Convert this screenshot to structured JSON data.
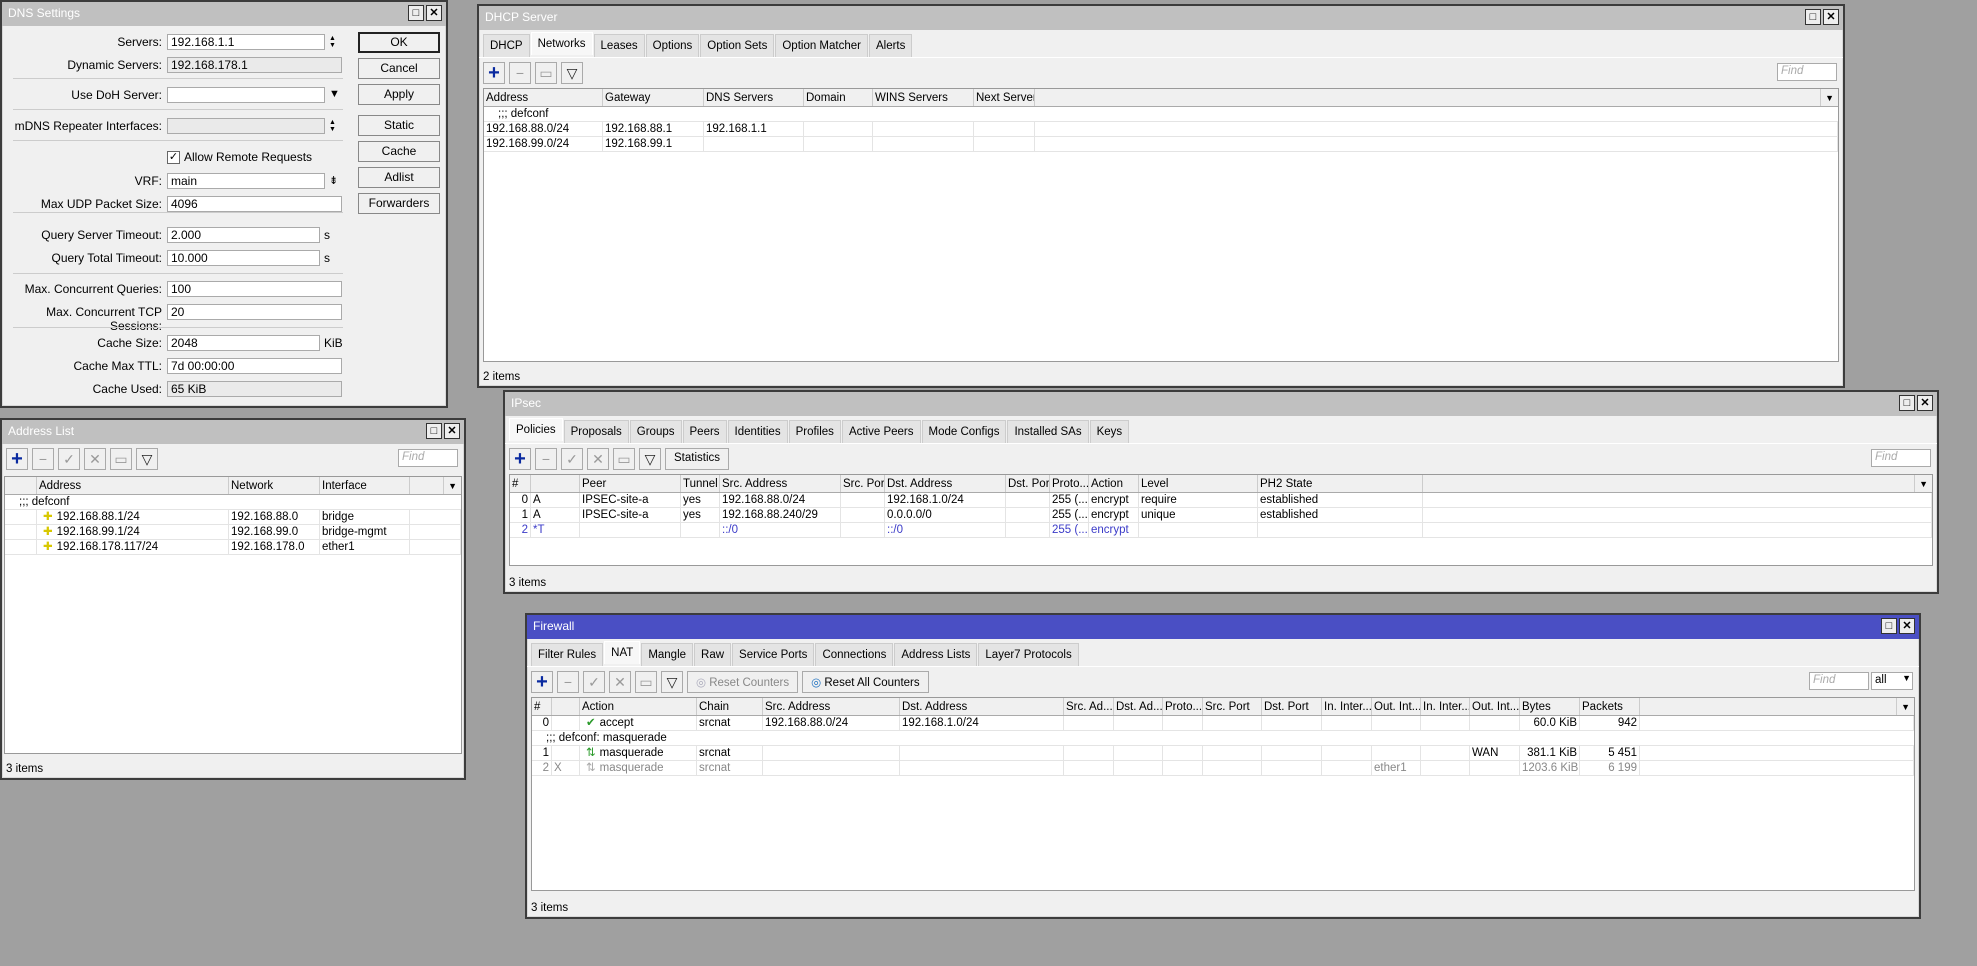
{
  "dns": {
    "title": "DNS Settings",
    "fields": [
      {
        "label": "Servers:",
        "value": "192.168.1.1",
        "ro": false
      },
      {
        "label": "Dynamic Servers:",
        "value": "192.168.178.1",
        "ro": true
      },
      {
        "label": "Use DoH Server:",
        "value": "",
        "ro": false
      },
      {
        "label": "mDNS Repeater Interfaces:",
        "value": "",
        "ro": true
      },
      {
        "label": "VRF:",
        "value": "main",
        "ro": false
      },
      {
        "label": "Max UDP Packet Size:",
        "value": "4096",
        "ro": false
      },
      {
        "label": "Query Server Timeout:",
        "value": "2.000",
        "ro": false,
        "unit": "s"
      },
      {
        "label": "Query Total Timeout:",
        "value": "10.000",
        "ro": false,
        "unit": "s"
      },
      {
        "label": "Max. Concurrent Queries:",
        "value": "100",
        "ro": false
      },
      {
        "label": "Max. Concurrent TCP Sessions:",
        "value": "20",
        "ro": false
      },
      {
        "label": "Cache Size:",
        "value": "2048",
        "ro": false,
        "unit": "KiB"
      },
      {
        "label": "Cache Max TTL:",
        "value": "7d 00:00:00",
        "ro": false
      },
      {
        "label": "Cache Used:",
        "value": "65 KiB",
        "ro": true
      }
    ],
    "allow_remote": {
      "label": "Allow Remote Requests",
      "checked": true
    },
    "buttons": [
      "OK",
      "Cancel",
      "Apply",
      "Static",
      "Cache",
      "Adlist",
      "Forwarders"
    ]
  },
  "addr": {
    "title": "Address List",
    "find": "Find",
    "status": "3 items",
    "columns": [
      "",
      "Address",
      "Network",
      "Interface",
      ""
    ],
    "comment": ";;; defconf",
    "rows": [
      [
        "",
        "192.168.88.1/24",
        "192.168.88.0",
        "bridge",
        ""
      ],
      [
        "",
        "192.168.99.1/24",
        "192.168.99.0",
        "bridge-mgmt",
        ""
      ],
      [
        "",
        "192.168.178.117/24",
        "192.168.178.0",
        "ether1",
        ""
      ]
    ]
  },
  "dhcp": {
    "title": "DHCP Server",
    "tabs": [
      "DHCP",
      "Networks",
      "Leases",
      "Options",
      "Option Sets",
      "Option Matcher",
      "Alerts"
    ],
    "selected_tab": 1,
    "find": "Find",
    "status": "2 items",
    "columns": [
      "Address",
      "Gateway",
      "DNS Servers",
      "Domain",
      "WINS Servers",
      "Next Server",
      ""
    ],
    "comment": ";;; defconf",
    "rows": [
      [
        "192.168.88.0/24",
        "192.168.88.1",
        "192.168.1.1",
        "",
        "",
        "",
        ""
      ],
      [
        "192.168.99.0/24",
        "192.168.99.1",
        "",
        "",
        "",
        "",
        ""
      ]
    ]
  },
  "ipsec": {
    "title": "IPsec",
    "tabs": [
      "Policies",
      "Proposals",
      "Groups",
      "Peers",
      "Identities",
      "Profiles",
      "Active Peers",
      "Mode Configs",
      "Installed SAs",
      "Keys"
    ],
    "selected_tab": 0,
    "statistics": "Statistics",
    "find": "Find",
    "status": "3 items",
    "columns": [
      "#",
      "",
      "Peer",
      "Tunnel",
      "Src. Address",
      "Src. Port",
      "Dst. Address",
      "Dst. Port",
      "Proto...",
      "Action",
      "Level",
      "PH2 State",
      ""
    ],
    "rows": [
      [
        "0",
        "A",
        "IPSEC-site-a",
        "yes",
        "192.168.88.0/24",
        "",
        "192.168.1.0/24",
        "",
        "255 (...",
        "encrypt",
        "require",
        "established",
        ""
      ],
      [
        "1",
        "A",
        "IPSEC-site-a",
        "yes",
        "192.168.88.240/29",
        "",
        "0.0.0.0/0",
        "",
        "255 (...",
        "encrypt",
        "unique",
        "established",
        ""
      ],
      [
        "2",
        "*T",
        "",
        "",
        "::/0",
        "",
        "::/0",
        "",
        "255 (...",
        "encrypt",
        "",
        "",
        ""
      ]
    ],
    "row_styles": [
      "",
      "",
      "blue"
    ]
  },
  "fw": {
    "title": "Firewall",
    "tabs": [
      "Filter Rules",
      "NAT",
      "Mangle",
      "Raw",
      "Service Ports",
      "Connections",
      "Address Lists",
      "Layer7 Protocols"
    ],
    "selected_tab": 1,
    "reset_counters": "Reset Counters",
    "reset_all_counters": "Reset All Counters",
    "find": "Find",
    "filter": "all",
    "status": "3 items",
    "columns": [
      "#",
      "",
      "Action",
      "Chain",
      "Src. Address",
      "Dst. Address",
      "Src. Ad...",
      "Dst. Ad...",
      "Proto...",
      "Src. Port",
      "Dst. Port",
      "In. Inter...",
      "Out. Int...",
      "In. Inter...",
      "Out. Int...",
      "Bytes",
      "Packets",
      ""
    ],
    "comment": ";;; defconf: masquerade",
    "rows": [
      [
        "0",
        "",
        "accept",
        "srcnat",
        "192.168.88.0/24",
        "192.168.1.0/24",
        "",
        "",
        "",
        "",
        "",
        "",
        "",
        "",
        "",
        "60.0 KiB",
        "942",
        ""
      ],
      [
        "1",
        "",
        "masquerade",
        "srcnat",
        "",
        "",
        "",
        "",
        "",
        "",
        "",
        "",
        "",
        "",
        "WAN",
        "381.1 KiB",
        "5 451",
        ""
      ],
      [
        "2",
        "X",
        "masquerade",
        "srcnat",
        "",
        "",
        "",
        "",
        "",
        "",
        "",
        "",
        "ether1",
        "",
        "",
        "1203.6 KiB",
        "6 199",
        ""
      ]
    ],
    "row_styles": [
      "",
      "",
      "gray"
    ],
    "colors": {
      "active_title": "#4a4fc4",
      "accept_icon": "#2a9a2a"
    }
  }
}
